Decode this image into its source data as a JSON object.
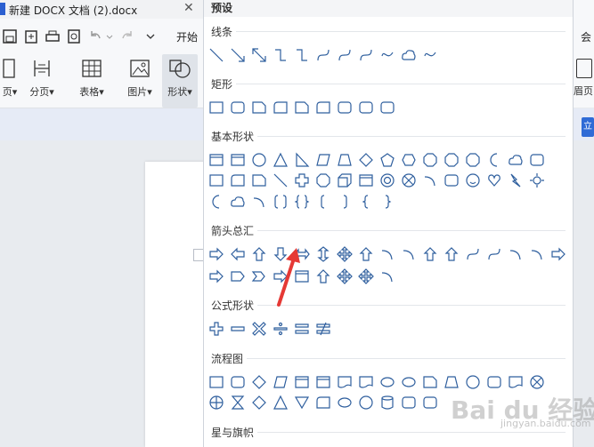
{
  "window": {
    "title": "新建 DOCX 文档 (2).docx",
    "close_glyph": "✕",
    "menu_start": "开始",
    "ribbon": [
      {
        "label": "页▾",
        "icon": "page-break-icon"
      },
      {
        "label": "分页▾",
        "icon": "section-break-icon"
      },
      {
        "label": "表格▾",
        "icon": "table-icon"
      },
      {
        "label": "图片▾",
        "icon": "picture-icon"
      },
      {
        "label": "形状▾",
        "icon": "shapes-icon"
      }
    ],
    "right_edge": {
      "menu": "会",
      "button": "眉页",
      "blue_button": "立"
    }
  },
  "panel": {
    "title": "预设",
    "sections": [
      {
        "key": "lines",
        "label": "线条"
      },
      {
        "key": "rect",
        "label": "矩形"
      },
      {
        "key": "basic",
        "label": "基本形状"
      },
      {
        "key": "arrows",
        "label": "箭头总汇"
      },
      {
        "key": "formula",
        "label": "公式形状"
      },
      {
        "key": "flowchart",
        "label": "流程图"
      },
      {
        "key": "stars",
        "label": "星与旗帜"
      }
    ]
  },
  "annotation": {
    "color": "#e53935",
    "icon": "red-pointer-arrow"
  },
  "watermark": {
    "text": "Bai du 经验",
    "sub": "jingyan.baidu.com"
  },
  "colors": {
    "shape_stroke": "#2f5f9e",
    "accent_blue": "#2f6bd6"
  }
}
